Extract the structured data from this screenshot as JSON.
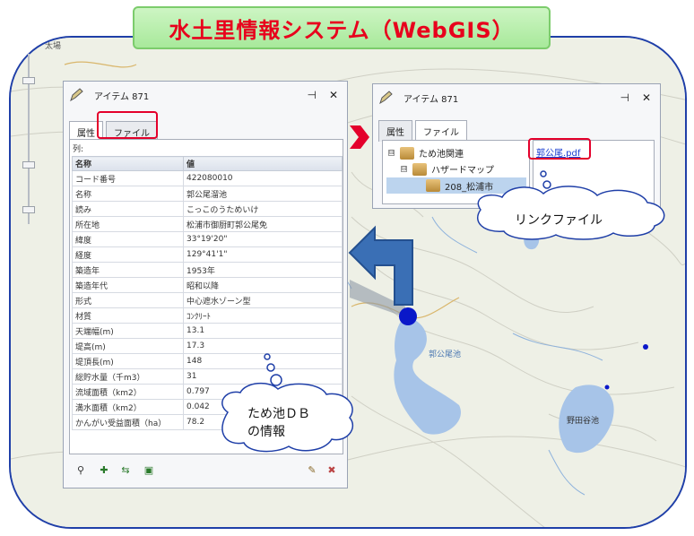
{
  "banner": {
    "title": "水土里情報システム（WebGIS）"
  },
  "attr_window": {
    "title": "アイテム 871",
    "pin_icon": "pin-icon",
    "close_label": "✕",
    "tabs": [
      {
        "label": "属性",
        "active": true
      },
      {
        "label": "ファイル",
        "active": false
      }
    ],
    "column_label": "列:",
    "headers": [
      "名称",
      "値"
    ],
    "rows": [
      [
        "コード番号",
        "422080010"
      ],
      [
        "名称",
        "郭公尾溜池"
      ],
      [
        "読み",
        "こっこのうためいけ"
      ],
      [
        "所在地",
        "松浦市御厨町郭公尾免"
      ],
      [
        "緯度",
        "33°19'20\""
      ],
      [
        "経度",
        "129°41'1\""
      ],
      [
        "築造年",
        "1953年"
      ],
      [
        "築造年代",
        "昭和以降"
      ],
      [
        "形式",
        "中心遮水ゾーン型"
      ],
      [
        "材質",
        "ｺﾝｸﾘｰﾄ"
      ],
      [
        "天端幅(m)",
        "13.1"
      ],
      [
        "堤高(m)",
        "17.3"
      ],
      [
        "堤頂長(m)",
        "148"
      ],
      [
        "総貯水量（千m3）",
        "31"
      ],
      [
        "流域面積（km2）",
        "0.797"
      ],
      [
        "満水面積（km2）",
        "0.042"
      ],
      [
        "かんがい受益面積（ha）",
        "78.2"
      ]
    ]
  },
  "file_window": {
    "title": "アイテム 871",
    "close_label": "✕",
    "tabs": [
      {
        "label": "属性",
        "active": false
      },
      {
        "label": "ファイル",
        "active": true
      }
    ],
    "tree": [
      {
        "label": "ため池関連",
        "level": 0,
        "toggle": "⊟"
      },
      {
        "label": "ハザードマップ",
        "level": 1,
        "toggle": "⊟"
      },
      {
        "label": "208_松浦市",
        "level": 2,
        "toggle": ""
      }
    ],
    "file_link": "郭公尾.pdf"
  },
  "callouts": {
    "link_file": "リンクファイル",
    "db_info_line1": "ため池ＤＢ",
    "db_info_line2": "の情報"
  },
  "map_labels": {
    "pond_label": "郭公尾池",
    "pond2_label": "野田谷池",
    "corner_label": "太場"
  },
  "colors": {
    "banner_text": "#e8001c",
    "frame": "#1f3fa8",
    "highlight_box": "#e4002b",
    "arrow_blue": "#3a6fb5",
    "water": "#a7c4e8",
    "marker": "#0a18c9"
  }
}
